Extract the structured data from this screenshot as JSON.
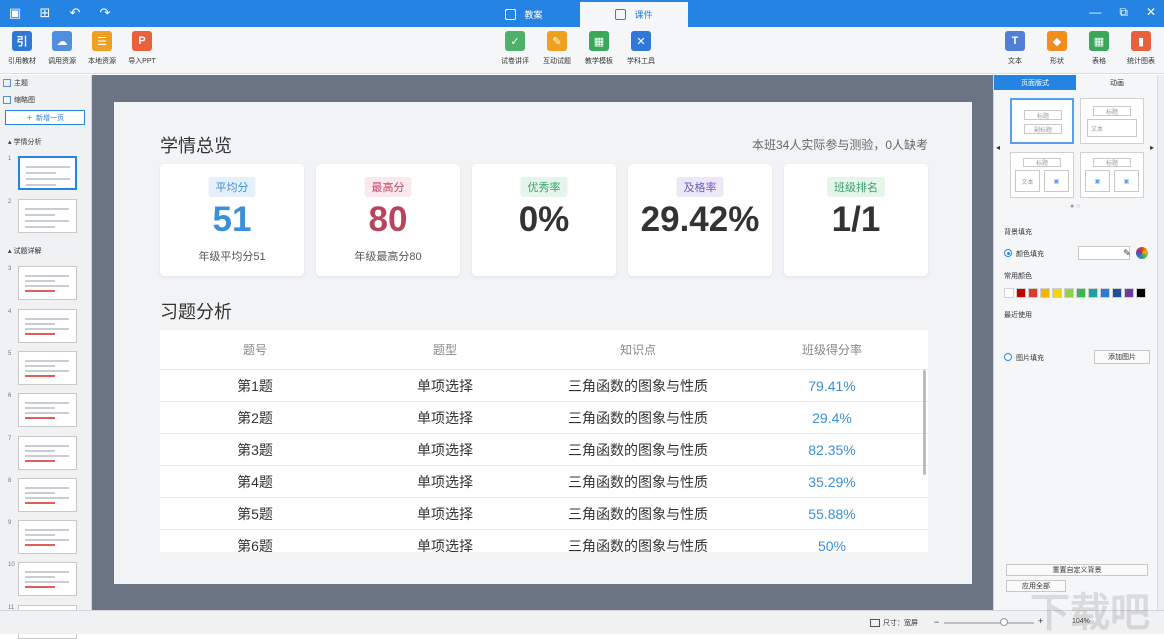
{
  "titlebar": {
    "tabs": [
      {
        "label": "教案"
      },
      {
        "label": "课件"
      }
    ],
    "controls": {
      "minimize": "—",
      "restore": "⧉",
      "close": "✕"
    }
  },
  "ribbon": {
    "left": [
      {
        "label": "引用教材",
        "icon": "book-ref-icon",
        "color": "#2f78d6"
      },
      {
        "label": "调用资源",
        "icon": "cloud-download-icon",
        "color": "#4f8fe0"
      },
      {
        "label": "本地资源",
        "icon": "folder-icon",
        "color": "#f0a020"
      },
      {
        "label": "导入PPT",
        "icon": "ppt-icon",
        "color": "#e8603c"
      }
    ],
    "middle": [
      {
        "label": "试卷讲评",
        "icon": "exam-review-icon",
        "color": "#4fb06a"
      },
      {
        "label": "互动试题",
        "icon": "interactive-question-icon",
        "color": "#f0a020"
      },
      {
        "label": "教学模板",
        "icon": "template-icon",
        "color": "#3aa85a"
      },
      {
        "label": "学科工具",
        "icon": "tools-icon",
        "color": "#2f78d6"
      }
    ],
    "right": [
      {
        "label": "文本",
        "icon": "text-icon",
        "color": "#4f7fd6"
      },
      {
        "label": "形状",
        "icon": "shape-icon",
        "color": "#f08c20"
      },
      {
        "label": "表格",
        "icon": "table-icon",
        "color": "#3aa85a"
      },
      {
        "label": "统计图表",
        "icon": "chart-icon",
        "color": "#e8603c"
      }
    ]
  },
  "leftpanel": {
    "theme": "主题",
    "thumbnails_label": "缩略图",
    "new_page": "新增一页",
    "section1": "学情分析",
    "section2": "试题详解",
    "slide_numbers": [
      "1",
      "2",
      "3",
      "4",
      "5",
      "6",
      "7",
      "8",
      "9",
      "10",
      "11"
    ]
  },
  "slide": {
    "title": "学情总览",
    "note": "本班34人实际参与测验，0人缺考",
    "cards": [
      {
        "badge": "平均分",
        "value": "51",
        "sub": "年级平均分51",
        "badge_bg": "#e5f0fb",
        "badge_color": "#3b8fd8",
        "value_color": "#3b8fd8"
      },
      {
        "badge": "最高分",
        "value": "80",
        "sub": "年级最高分80",
        "badge_bg": "#fbe8ec",
        "badge_color": "#c04664",
        "value_color": "#b8455e"
      },
      {
        "badge": "优秀率",
        "value": "0%",
        "sub": "",
        "badge_bg": "#e4f6ec",
        "badge_color": "#3aa06a",
        "value_color": "#333333"
      },
      {
        "badge": "及格率",
        "value": "29.42%",
        "sub": "",
        "badge_bg": "#ede8f8",
        "badge_color": "#6b5bbf",
        "value_color": "#333333"
      },
      {
        "badge": "班级排名",
        "value": "1/1",
        "sub": "",
        "badge_bg": "#e6f5ea",
        "badge_color": "#3aa06a",
        "value_color": "#333333"
      }
    ],
    "section_title": "习题分析",
    "table": {
      "headers": [
        "题号",
        "题型",
        "知识点",
        "班级得分率"
      ],
      "rows": [
        [
          "第1题",
          "单项选择",
          "三角函数的图象与性质",
          "79.41%"
        ],
        [
          "第2题",
          "单项选择",
          "三角函数的图象与性质",
          "29.4%"
        ],
        [
          "第3题",
          "单项选择",
          "三角函数的图象与性质",
          "82.35%"
        ],
        [
          "第4题",
          "单项选择",
          "三角函数的图象与性质",
          "35.29%"
        ],
        [
          "第5题",
          "单项选择",
          "三角函数的图象与性质",
          "55.88%"
        ],
        [
          "第6题",
          "单项选择",
          "三角函数的图象与性质",
          "50%"
        ]
      ]
    }
  },
  "rightpanel": {
    "tabs": [
      "页面版式",
      "动画"
    ],
    "layout_labels": {
      "title": "标题",
      "subtitle": "副标题",
      "text": "文本"
    },
    "background_fill": "背景填充",
    "color_fill": "颜色填充",
    "common_colors": "常用颜色",
    "swatches": [
      "#ffffff",
      "#c00000",
      "#e23a2a",
      "#f7b500",
      "#f2d400",
      "#92d050",
      "#3fb34f",
      "#1fa0a0",
      "#2f78d6",
      "#1f4e9a",
      "#6f3b9e",
      "#000000"
    ],
    "recent": "最近使用",
    "image_fill": "图片填充",
    "add_image": "添加图片",
    "reset_bg": "重置自定义背景",
    "apply_all": "应用全部"
  },
  "statusbar": {
    "size_label": "尺寸：宽屏",
    "zoom": "104%"
  },
  "watermark": "下载吧"
}
